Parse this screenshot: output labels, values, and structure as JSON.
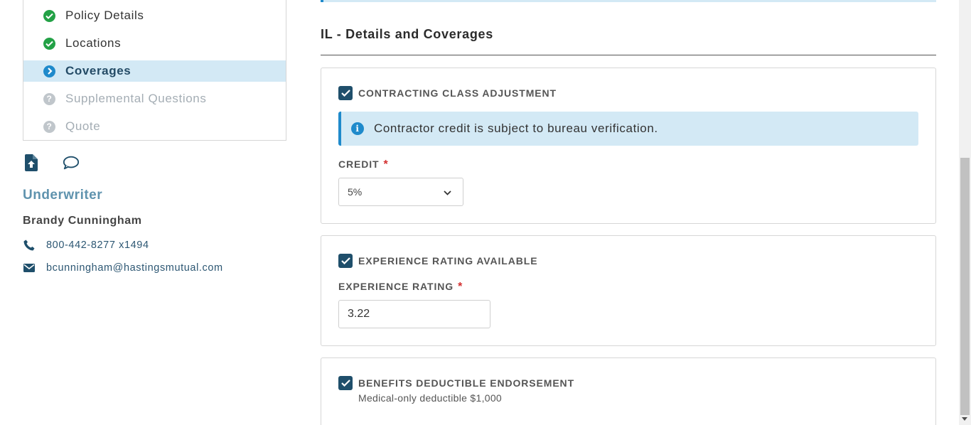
{
  "sidebar": {
    "steps": [
      {
        "label": "Policy Details",
        "state": "done"
      },
      {
        "label": "Locations",
        "state": "done"
      },
      {
        "label": "Coverages",
        "state": "current"
      },
      {
        "label": "Supplemental Questions",
        "state": "todo"
      },
      {
        "label": "Quote",
        "state": "todo"
      }
    ],
    "tools": {
      "upload_icon": "file-upload-icon",
      "chat_icon": "comment-icon"
    },
    "underwriter": {
      "title": "Underwriter",
      "name": "Brandy Cunningham",
      "phone": "800-442-8277 x1494",
      "email": "bcunningham@hastingsmutual.com"
    }
  },
  "main": {
    "section_title": "IL - Details and Coverages",
    "contracting": {
      "checkbox_label": "CONTRACTING CLASS ADJUSTMENT",
      "checked": true,
      "alert": "Contractor credit is subject to bureau verification.",
      "credit_label": "CREDIT",
      "required_mark": "*",
      "credit_value": "5%"
    },
    "experience": {
      "checkbox_label": "EXPERIENCE RATING AVAILABLE",
      "checked": true,
      "field_label": "EXPERIENCE RATING",
      "required_mark": "*",
      "value": "3.22"
    },
    "benefits": {
      "checkbox_label": "BENEFITS DEDUCTIBLE ENDORSEMENT",
      "checked": true,
      "note": "Medical-only deductible $1,000"
    }
  },
  "colors": {
    "accent": "#1f8acb",
    "checkbox": "#1f4f6b",
    "done": "#23a146",
    "current_bg": "#d3e9f5",
    "underwriter_title": "#5f93ae",
    "required": "#d32f2f"
  }
}
